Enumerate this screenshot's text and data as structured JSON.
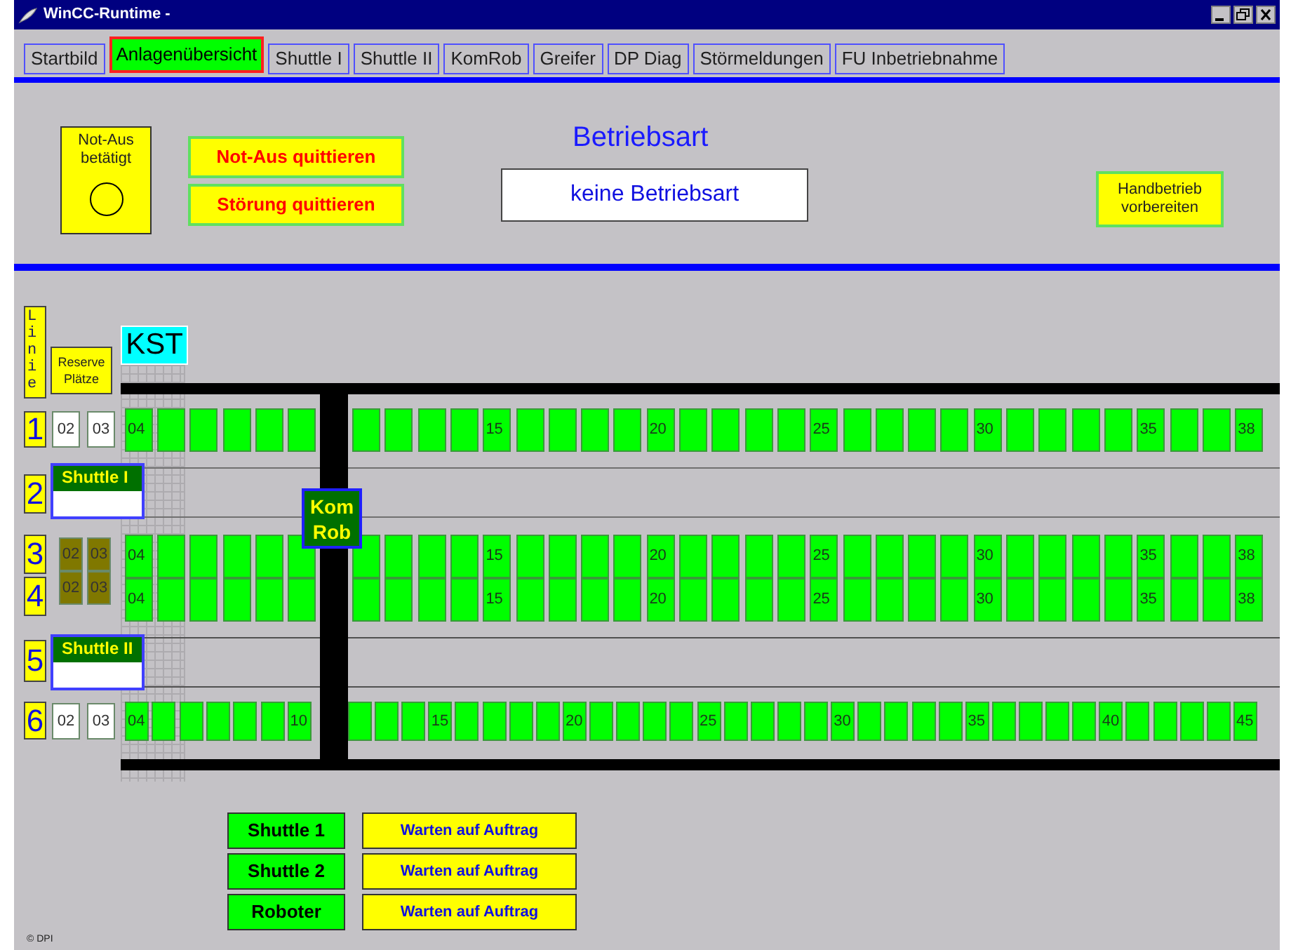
{
  "window": {
    "title": "WinCC-Runtime -"
  },
  "tabs": [
    {
      "label": "Startbild",
      "selected": false
    },
    {
      "label": "Anlagenübersicht",
      "selected": true
    },
    {
      "label": "Shuttle I",
      "selected": false
    },
    {
      "label": "Shuttle II",
      "selected": false
    },
    {
      "label": "KomRob",
      "selected": false
    },
    {
      "label": "Greifer",
      "selected": false
    },
    {
      "label": "DP Diag",
      "selected": false
    },
    {
      "label": "Störmeldungen",
      "selected": false
    },
    {
      "label": "FU Inbetriebnahme",
      "selected": false
    }
  ],
  "header": {
    "emergency": {
      "label": "Not-Aus betätigt",
      "on": false
    },
    "buttons": [
      {
        "label": "Not-Aus quittieren"
      },
      {
        "label": "Störung quittieren"
      }
    ],
    "mode_title": "Betriebsart",
    "mode_value": "keine Betriebsart",
    "manual_button": "Handbetrieb vorbereiten"
  },
  "diagram": {
    "line_title": "Linie",
    "reserve_title": "Reserve Plätze",
    "kst": "KST",
    "robot": "Kom Rob",
    "lines": [
      {
        "number": "1",
        "kind": "track",
        "reserve": [
          {
            "label": "02",
            "color": "#ffffff"
          },
          {
            "label": "03",
            "color": "#ffffff"
          }
        ],
        "slots_left": [
          {
            "label": "04",
            "color": "#00ff00"
          },
          {
            "color": "#00ff00"
          },
          {
            "color": "#00ff00"
          },
          {
            "color": "#00ff00"
          },
          {
            "color": "#00ff00"
          },
          {
            "color": "#00ff00"
          }
        ],
        "slots_right": [
          {
            "color": "#00ff00"
          },
          {
            "color": "#00ff00"
          },
          {
            "color": "#00ff00"
          },
          {
            "color": "#00ff00"
          },
          {
            "label": "15",
            "color": "#00ff00"
          },
          {
            "color": "#00ff00"
          },
          {
            "color": "#00ff00"
          },
          {
            "color": "#00ff00"
          },
          {
            "color": "#00ff00"
          },
          {
            "label": "20",
            "color": "#00ff00"
          },
          {
            "color": "#00ff00"
          },
          {
            "color": "#00ff00"
          },
          {
            "color": "#00ff00"
          },
          {
            "color": "#00ff00"
          },
          {
            "label": "25",
            "color": "#00ff00"
          },
          {
            "color": "#00ff00"
          },
          {
            "color": "#00ff00"
          },
          {
            "color": "#00ff00"
          },
          {
            "color": "#00ff00"
          },
          {
            "label": "30",
            "color": "#00ff00"
          },
          {
            "color": "#00ff00"
          },
          {
            "color": "#00ff00"
          },
          {
            "color": "#00ff00"
          },
          {
            "color": "#00ff00"
          },
          {
            "label": "35",
            "color": "#00ff00"
          },
          {
            "color": "#00ff00"
          },
          {
            "color": "#00ff00"
          },
          {
            "label": "38",
            "color": "#00ff00"
          }
        ]
      },
      {
        "number": "2",
        "kind": "shuttle",
        "shuttle": "Shuttle I"
      },
      {
        "number": "3",
        "kind": "track",
        "reserve": [
          {
            "label": "02",
            "color": "#807800"
          },
          {
            "label": "03",
            "color": "#807800"
          }
        ],
        "slots_left": [
          {
            "label": "04",
            "color": "#00ff00"
          },
          {
            "color": "#00ff00"
          },
          {
            "color": "#00ff00"
          },
          {
            "color": "#00ff00"
          },
          {
            "color": "#00ff00"
          },
          {
            "color": "#00ff00"
          }
        ],
        "slots_right": [
          {
            "color": "#00ff00"
          },
          {
            "color": "#00ff00"
          },
          {
            "color": "#00ff00"
          },
          {
            "color": "#00ff00"
          },
          {
            "label": "15",
            "color": "#00ff00"
          },
          {
            "color": "#00ff00"
          },
          {
            "color": "#00ff00"
          },
          {
            "color": "#00ff00"
          },
          {
            "color": "#00ff00"
          },
          {
            "label": "20",
            "color": "#00ff00"
          },
          {
            "color": "#00ff00"
          },
          {
            "color": "#00ff00"
          },
          {
            "color": "#00ff00"
          },
          {
            "color": "#00ff00"
          },
          {
            "label": "25",
            "color": "#00ff00"
          },
          {
            "color": "#00ff00"
          },
          {
            "color": "#00ff00"
          },
          {
            "color": "#00ff00"
          },
          {
            "color": "#00ff00"
          },
          {
            "label": "30",
            "color": "#00ff00"
          },
          {
            "color": "#00ff00"
          },
          {
            "color": "#00ff00"
          },
          {
            "color": "#00ff00"
          },
          {
            "color": "#00ff00"
          },
          {
            "label": "35",
            "color": "#00ff00"
          },
          {
            "color": "#00ff00"
          },
          {
            "color": "#00ff00"
          },
          {
            "label": "38",
            "color": "#00ff00"
          }
        ]
      },
      {
        "number": "4",
        "kind": "track",
        "reserve": [
          {
            "label": "02",
            "color": "#807800"
          },
          {
            "label": "03",
            "color": "#807800"
          }
        ],
        "slots_left": [
          {
            "label": "04",
            "color": "#00ff00"
          },
          {
            "color": "#00ff00"
          },
          {
            "color": "#00ff00"
          },
          {
            "color": "#00ff00"
          },
          {
            "color": "#00ff00"
          },
          {
            "color": "#00ff00"
          }
        ],
        "slots_right": [
          {
            "color": "#00ff00"
          },
          {
            "color": "#00ff00"
          },
          {
            "color": "#00ff00"
          },
          {
            "color": "#00ff00"
          },
          {
            "label": "15",
            "color": "#00ff00"
          },
          {
            "color": "#00ff00"
          },
          {
            "color": "#00ff00"
          },
          {
            "color": "#00ff00"
          },
          {
            "color": "#00ff00"
          },
          {
            "label": "20",
            "color": "#00ff00"
          },
          {
            "color": "#00ff00"
          },
          {
            "color": "#00ff00"
          },
          {
            "color": "#00ff00"
          },
          {
            "color": "#00ff00"
          },
          {
            "label": "25",
            "color": "#00ff00"
          },
          {
            "color": "#00ff00"
          },
          {
            "color": "#00ff00"
          },
          {
            "color": "#00ff00"
          },
          {
            "color": "#00ff00"
          },
          {
            "label": "30",
            "color": "#00ff00"
          },
          {
            "color": "#00ff00"
          },
          {
            "color": "#00ff00"
          },
          {
            "color": "#00ff00"
          },
          {
            "color": "#00ff00"
          },
          {
            "label": "35",
            "color": "#00ff00"
          },
          {
            "color": "#00ff00"
          },
          {
            "color": "#00ff00"
          },
          {
            "label": "38",
            "color": "#00ff00"
          }
        ]
      },
      {
        "number": "5",
        "kind": "shuttle",
        "shuttle": "Shuttle II"
      },
      {
        "number": "6",
        "kind": "track",
        "reserve": [
          {
            "label": "02",
            "color": "#ffffff"
          },
          {
            "label": "03",
            "color": "#ffffff"
          }
        ],
        "slots_left": [
          {
            "label": "04",
            "color": "#00ff00"
          },
          {
            "color": "#00ff00"
          },
          {
            "color": "#00ff00"
          },
          {
            "color": "#00ff00"
          },
          {
            "color": "#00ff00"
          },
          {
            "color": "#00ff00"
          },
          {
            "label": "10",
            "color": "#00ff00"
          }
        ],
        "slots_right": [
          {
            "color": "#00ff00"
          },
          {
            "color": "#00ff00"
          },
          {
            "color": "#00ff00"
          },
          {
            "label": "15",
            "color": "#00ff00"
          },
          {
            "color": "#00ff00"
          },
          {
            "color": "#00ff00"
          },
          {
            "color": "#00ff00"
          },
          {
            "color": "#00ff00"
          },
          {
            "label": "20",
            "color": "#00ff00"
          },
          {
            "color": "#00ff00"
          },
          {
            "color": "#00ff00"
          },
          {
            "color": "#00ff00"
          },
          {
            "color": "#00ff00"
          },
          {
            "label": "25",
            "color": "#00ff00"
          },
          {
            "color": "#00ff00"
          },
          {
            "color": "#00ff00"
          },
          {
            "color": "#00ff00"
          },
          {
            "color": "#00ff00"
          },
          {
            "label": "30",
            "color": "#00ff00"
          },
          {
            "color": "#00ff00"
          },
          {
            "color": "#00ff00"
          },
          {
            "color": "#00ff00"
          },
          {
            "color": "#00ff00"
          },
          {
            "label": "35",
            "color": "#00ff00"
          },
          {
            "color": "#00ff00"
          },
          {
            "color": "#00ff00"
          },
          {
            "color": "#00ff00"
          },
          {
            "color": "#00ff00"
          },
          {
            "label": "40",
            "color": "#00ff00"
          },
          {
            "color": "#00ff00"
          },
          {
            "color": "#00ff00"
          },
          {
            "color": "#00ff00"
          },
          {
            "color": "#00ff00"
          },
          {
            "label": "45",
            "color": "#00ff00"
          }
        ]
      }
    ]
  },
  "units": [
    {
      "name": "Shuttle 1",
      "status": "Warten auf Auftrag"
    },
    {
      "name": "Shuttle 2",
      "status": "Warten auf Auftrag"
    },
    {
      "name": "Roboter",
      "status": "Warten auf Auftrag"
    }
  ],
  "footer": "© DPI"
}
